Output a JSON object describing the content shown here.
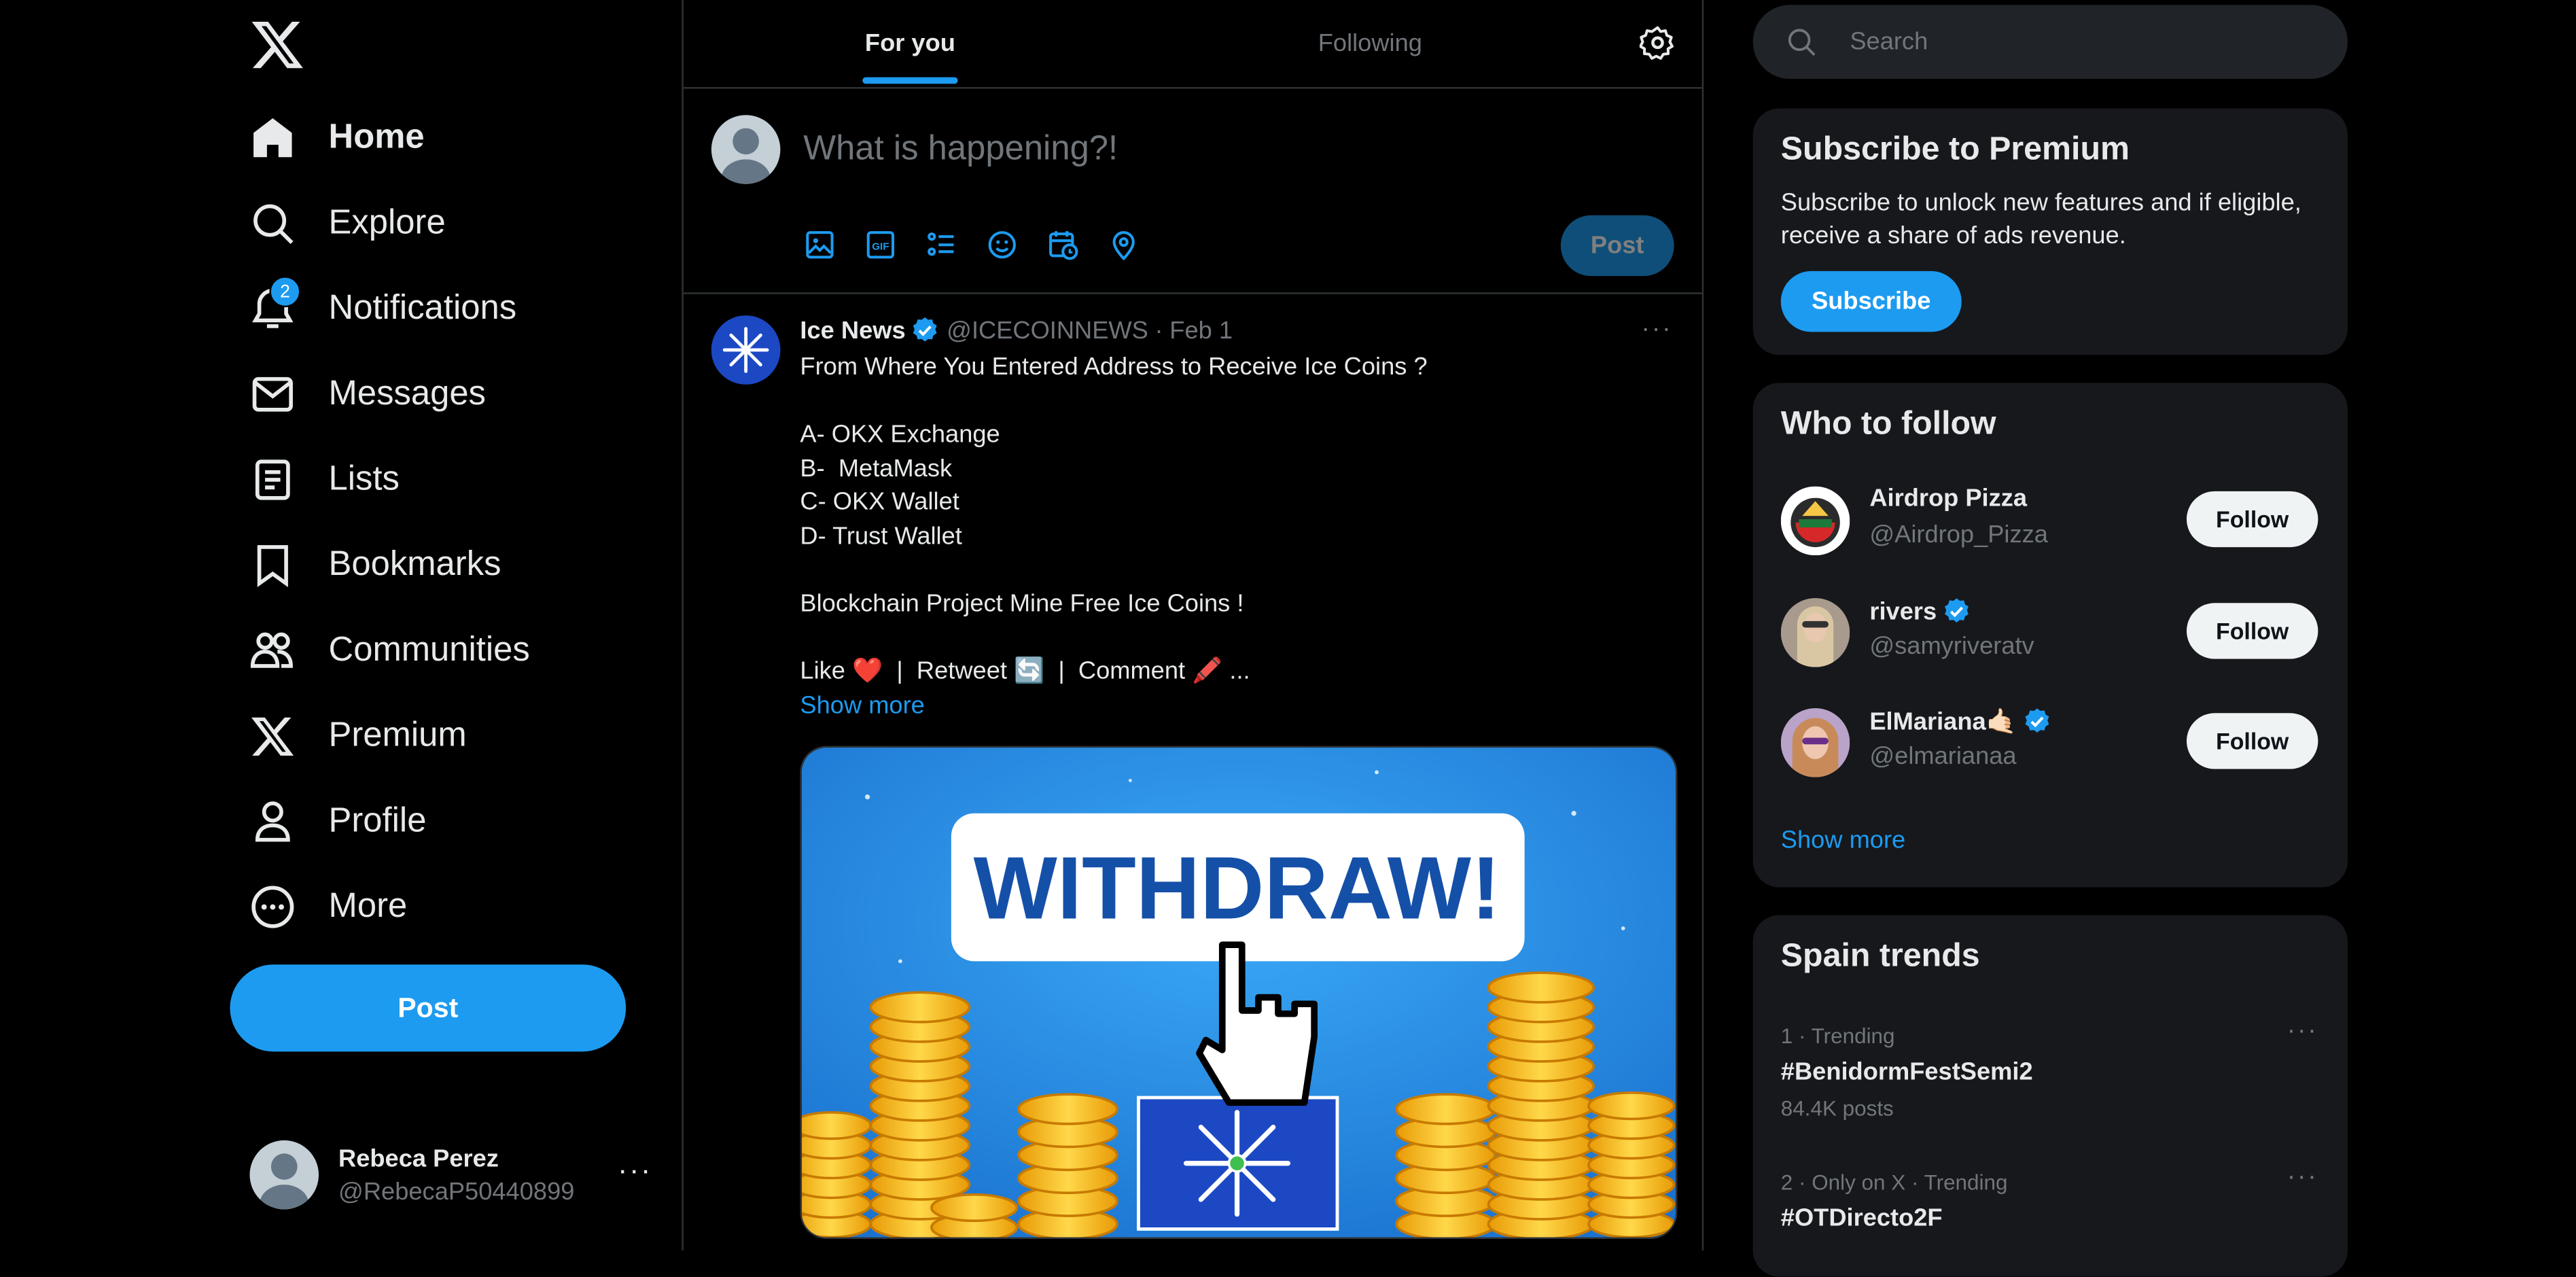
{
  "nav": {
    "items": [
      {
        "label": "Home",
        "icon": "home-icon"
      },
      {
        "label": "Explore",
        "icon": "search-icon"
      },
      {
        "label": "Notifications",
        "icon": "bell-icon",
        "badge": "2"
      },
      {
        "label": "Messages",
        "icon": "envelope-icon"
      },
      {
        "label": "Lists",
        "icon": "list-icon"
      },
      {
        "label": "Bookmarks",
        "icon": "bookmark-icon"
      },
      {
        "label": "Communities",
        "icon": "people-icon"
      },
      {
        "label": "Premium",
        "icon": "x-logo-icon"
      },
      {
        "label": "Profile",
        "icon": "person-icon"
      },
      {
        "label": "More",
        "icon": "more-circle-icon"
      }
    ],
    "post_label": "Post",
    "account": {
      "name": "Rebeca Perez",
      "handle": "@RebecaP50440899",
      "more": "···"
    }
  },
  "main": {
    "tabs": [
      {
        "label": "For you"
      },
      {
        "label": "Following"
      }
    ],
    "composer": {
      "placeholder": "What is happening?!",
      "post_label": "Post"
    },
    "tweet": {
      "name": "Ice News",
      "handle": "@ICECOINNEWS",
      "sep": "·",
      "date": "Feb 1",
      "more": "···",
      "lines": [
        "From Where You Entered Address to Receive Ice Coins ?",
        "",
        "A- OKX Exchange",
        "B-  MetaMask",
        "C- OKX Wallet",
        "D- Trust Wallet",
        "",
        "Blockchain Project Mine Free Ice Coins !",
        "",
        "Like ❤️  |  Retweet 🔄  |  Comment 🖍️ ..."
      ],
      "show_more": "Show more",
      "image_text": "WITHDRAW!"
    }
  },
  "sidebar": {
    "search_placeholder": "Search",
    "premium": {
      "title": "Subscribe to Premium",
      "desc": "Subscribe to unlock new features and if eligible, receive a share of ads revenue.",
      "button": "Subscribe"
    },
    "who_to_follow": {
      "title": "Who to follow",
      "users": [
        {
          "name": "Airdrop Pizza",
          "handle": "@Airdrop_Pizza",
          "verified": false,
          "button": "Follow"
        },
        {
          "name": "rivers",
          "handle": "@samyriveratv",
          "verified": true,
          "button": "Follow"
        },
        {
          "name": "ElMariana🤙🏻",
          "handle": "@elmarianaa",
          "verified": true,
          "button": "Follow"
        }
      ],
      "show_more": "Show more"
    },
    "trends": {
      "title": "Spain trends",
      "items": [
        {
          "meta": "1 · Trending",
          "name": "#BenidormFestSemi2",
          "count": "84.4K posts"
        },
        {
          "meta": "2 · Only on X · Trending",
          "name": "#OTDirecto2F",
          "count": ""
        }
      ]
    }
  },
  "colors": {
    "accent": "#1d9bf0",
    "background": "#000000",
    "card": "#16181c",
    "muted": "#71767b"
  }
}
